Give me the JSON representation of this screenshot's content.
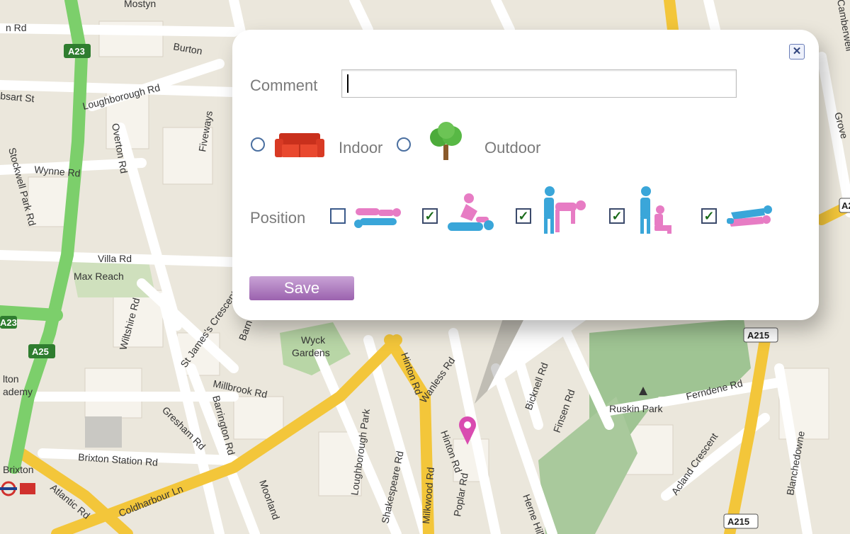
{
  "map": {
    "shields": {
      "a23_top": "A23",
      "a23_mid": "A23",
      "a23_bottom": "A25",
      "a215_right": "A215",
      "a215_top": "A215",
      "a215_bottom": "A215"
    },
    "labels": {
      "mostyn": "Mostyn",
      "lin_rd": "n Rd",
      "burton": "Burton",
      "loughborough_rd": "Loughborough Rd",
      "bosart": "bsart St",
      "overton": "Overton Rd",
      "wynne": "Wynne Rd",
      "stockwell_park": "Stockwell Park Rd",
      "villa": "Villa Rd",
      "max_reach": "Max Reach",
      "wiltshire": "Wiltshire Rd",
      "st_james": "St James's Crescent",
      "barn": "Barn",
      "wyck": "Wyck",
      "gardens": "Gardens",
      "millbrook": "Millbrook Rd",
      "gresham": "Gresham Rd",
      "barrington": "Barrington Rd",
      "brixton_station": "Brixton Station Rd",
      "coldharbour": "Coldharbour Ln",
      "atlantic": "Atlantic Rd",
      "brixton": "Brixton",
      "loughborough_park": "Loughborough Park",
      "shakespeare": "Shakespeare Rd",
      "milkwood": "Milkwood Rd",
      "poplar": "Poplar Rd",
      "moorland": "Moorland",
      "herne": "Herne Hill",
      "hinton_rd": "Hinton Rd",
      "hinton_rd2": "Hinton Rd",
      "wanless": "Wanless Rd",
      "bicknell": "Bicknell Rd",
      "finsen": "Finsen Rd",
      "ruskin_park": "Ruskin Park",
      "ferndene": "Ferndene Rd",
      "acland": "Acland Crescent",
      "blanchedowne": "Blanchedowne",
      "grove": "Grove",
      "camberwell": "Camberwell",
      "ldon": "lton",
      "ademy": "ademy",
      "fiveways": "Fiveways"
    }
  },
  "popup": {
    "close_symbol": "✕",
    "comment_label": "Comment",
    "comment_value": "",
    "indoor_label": "Indoor",
    "outdoor_label": "Outdoor",
    "position_label": "Position",
    "positions": [
      {
        "checked": false
      },
      {
        "checked": true
      },
      {
        "checked": true
      },
      {
        "checked": true
      },
      {
        "checked": true
      }
    ],
    "checkmark": "✓",
    "save_label": "Save"
  },
  "colors": {
    "green_road": "#7ccf6b",
    "yellow_road": "#f3c63a",
    "pink": "#e77cc4",
    "blue": "#3aa6d9",
    "sofa_red": "#d83a24",
    "tree_green": "#4cab3a"
  }
}
